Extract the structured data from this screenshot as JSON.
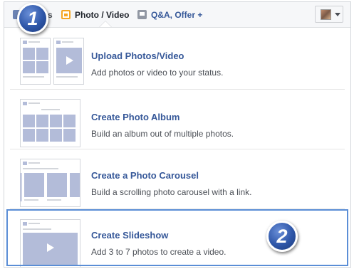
{
  "tabs": [
    {
      "label": "Status",
      "icon": "status-icon"
    },
    {
      "label": "Photo / Video",
      "icon": "photo-icon"
    },
    {
      "label": "Q&A, Offer +",
      "icon": "qa-icon"
    }
  ],
  "privacy": {
    "icon": "avatar",
    "caret": "chevron-down-icon"
  },
  "menu": [
    {
      "title": "Upload Photos/Video",
      "desc": "Add photos or video to your status."
    },
    {
      "title": "Create Photo Album",
      "desc": "Build an album out of multiple photos."
    },
    {
      "title": "Create a Photo Carousel",
      "desc": "Build a scrolling photo carousel with a link."
    },
    {
      "title": "Create Slideshow",
      "desc": "Add 3 to 7 photos to create a video."
    }
  ],
  "badges": {
    "step1": "1",
    "step2": "2"
  },
  "colors": {
    "link": "#365899",
    "selection_border": "#5b8ed6",
    "thumb_fill": "#b3bcd9",
    "badge": "#2e56a8"
  }
}
